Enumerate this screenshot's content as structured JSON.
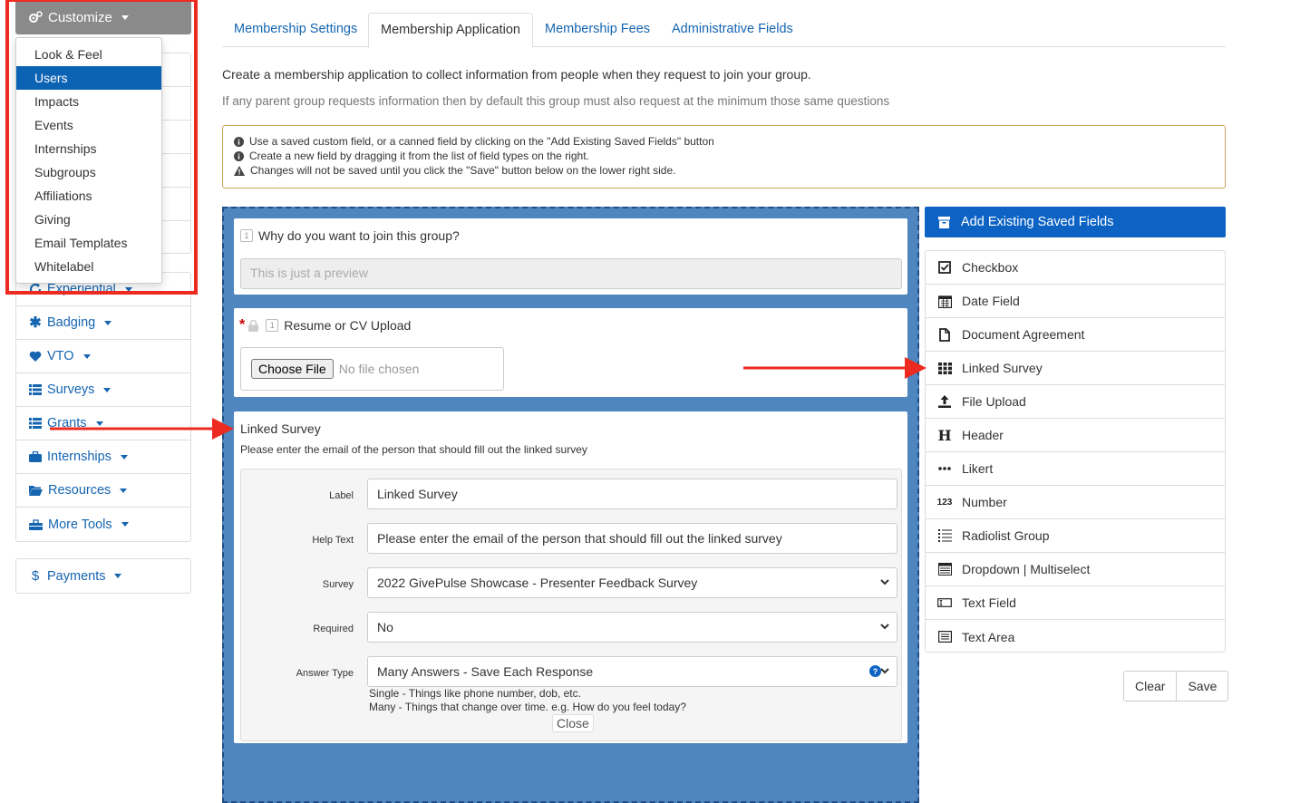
{
  "sidebar": {
    "customize_label": "Customize",
    "dropdown_items": [
      "Look & Feel",
      "Users",
      "Impacts",
      "Events",
      "Internships",
      "Subgroups",
      "Affiliations",
      "Giving",
      "Email Templates",
      "Whitelabel"
    ],
    "active_item": "Users",
    "partial_item": "Experiential",
    "items": [
      {
        "label": "Badging",
        "icon": "asterisk-icon"
      },
      {
        "label": "VTO",
        "icon": "heart-icon"
      },
      {
        "label": "Surveys",
        "icon": "list-icon"
      },
      {
        "label": "Grants",
        "icon": "list-icon"
      },
      {
        "label": "Internships",
        "icon": "briefcase-icon"
      },
      {
        "label": "Resources",
        "icon": "folder-icon"
      },
      {
        "label": "More Tools",
        "icon": "toolbox-icon"
      }
    ],
    "payments_label": "Payments"
  },
  "tabs": [
    "Membership Settings",
    "Membership Application",
    "Membership Fees",
    "Administrative Fields"
  ],
  "active_tab": "Membership Application",
  "intro": {
    "line1": "Create a membership application to collect information from people when they request to join your group.",
    "line2": "If any parent group requests information then by default this group must also request at the minimum those same questions"
  },
  "notice": {
    "line1": "Use a saved custom field, or a canned field by clicking on the \"Add Existing Saved Fields\" button",
    "line2": "Create a new field by dragging it from the list of field types on the right.",
    "line3": "Changes will not be saved until you click the \"Save\" button below on the lower right side."
  },
  "form": {
    "q1": {
      "number": "1",
      "label": "Why do you want to join this group?",
      "placeholder": "This is just a preview"
    },
    "q2": {
      "number": "1",
      "label": "Resume or CV Upload",
      "required_mark": "*",
      "choose_label": "Choose File",
      "no_file": "No file chosen"
    },
    "q3": {
      "title": "Linked Survey",
      "help": "Please enter the email of the person that should fill out the linked survey",
      "label_label": "Label",
      "label_value": "Linked Survey",
      "helptext_label": "Help Text",
      "helptext_value": "Please enter the email of the person that should fill out the linked survey",
      "survey_label": "Survey",
      "survey_value": "2022 GivePulse Showcase - Presenter Feedback Survey",
      "required_label": "Required",
      "required_value": "No",
      "answertype_label": "Answer Type",
      "answertype_value": "Many Answers - Save Each Response",
      "hint1": "Single - Things like phone number, dob, etc.",
      "hint2": "Many - Things that change over time. e.g. How do you feel today?",
      "close_label": "Close"
    }
  },
  "right_panel": {
    "add_existing_label": "Add Existing Saved Fields",
    "field_types": [
      {
        "label": "Checkbox",
        "icon": "checkbox-icon"
      },
      {
        "label": "Date Field",
        "icon": "calendar-icon"
      },
      {
        "label": "Document Agreement",
        "icon": "document-icon"
      },
      {
        "label": "Linked Survey",
        "icon": "grid-icon"
      },
      {
        "label": "File Upload",
        "icon": "upload-icon"
      },
      {
        "label": "Header",
        "icon": "header-icon",
        "glyph": "H"
      },
      {
        "label": "Likert",
        "icon": "ellipsis-icon"
      },
      {
        "label": "Number",
        "icon": "number-icon",
        "glyph": "123"
      },
      {
        "label": "Radiolist Group",
        "icon": "radiolist-icon"
      },
      {
        "label": "Dropdown | Multiselect",
        "icon": "dropdown-icon"
      },
      {
        "label": "Text Field",
        "icon": "textfield-icon"
      },
      {
        "label": "Text Area",
        "icon": "textarea-icon"
      }
    ],
    "clear_label": "Clear",
    "save_label": "Save"
  },
  "colors": {
    "annotation_red": "#ec2a20",
    "primary_blue": "#0d63c4",
    "link_blue": "#1565b0",
    "form_bg": "#4f86bf"
  }
}
